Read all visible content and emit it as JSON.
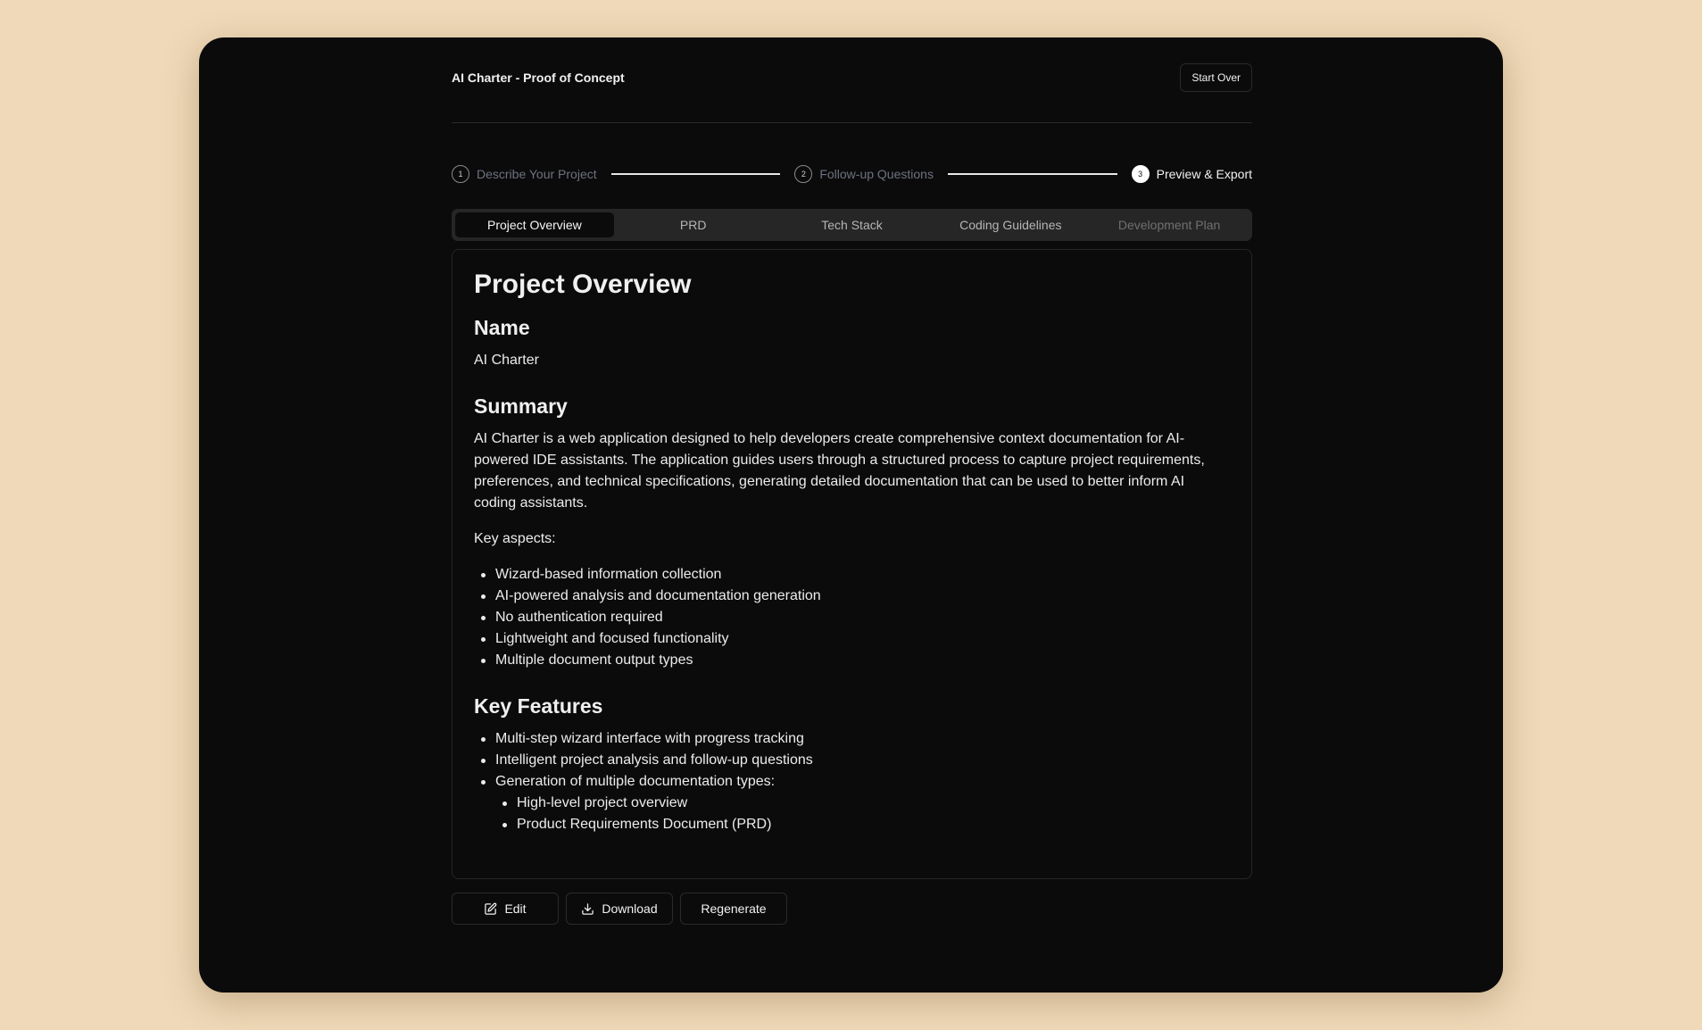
{
  "header": {
    "title": "AI Charter - Proof of Concept",
    "start_over_label": "Start Over"
  },
  "stepper": {
    "steps": [
      {
        "number": "1",
        "label": "Describe Your Project",
        "state": "complete"
      },
      {
        "number": "2",
        "label": "Follow-up Questions",
        "state": "complete"
      },
      {
        "number": "3",
        "label": "Preview & Export",
        "state": "active"
      }
    ]
  },
  "tabs": [
    {
      "label": "Project Overview",
      "active": true
    },
    {
      "label": "PRD",
      "active": false
    },
    {
      "label": "Tech Stack",
      "active": false
    },
    {
      "label": "Coding Guidelines",
      "active": false
    },
    {
      "label": "Development Plan",
      "active": false
    }
  ],
  "document": {
    "title": "Project Overview",
    "name_heading": "Name",
    "name_value": "AI Charter",
    "summary_heading": "Summary",
    "summary_text": "AI Charter is a web application designed to help developers create comprehensive context documentation for AI-powered IDE assistants. The application guides users through a structured process to capture project requirements, preferences, and technical specifications, generating detailed documentation that can be used to better inform AI coding assistants.",
    "key_aspects_label": "Key aspects:",
    "key_aspects": [
      "Wizard-based information collection",
      "AI-powered analysis and documentation generation",
      "No authentication required",
      "Lightweight and focused functionality",
      "Multiple document output types"
    ],
    "key_features_heading": "Key Features",
    "key_features": [
      "Multi-step wizard interface with progress tracking",
      "Intelligent project analysis and follow-up questions",
      "Generation of multiple documentation types:"
    ],
    "documentation_types": [
      "High-level project overview",
      "Product Requirements Document (PRD)"
    ]
  },
  "actions": {
    "edit_label": "Edit",
    "download_label": "Download",
    "regenerate_label": "Regenerate"
  }
}
